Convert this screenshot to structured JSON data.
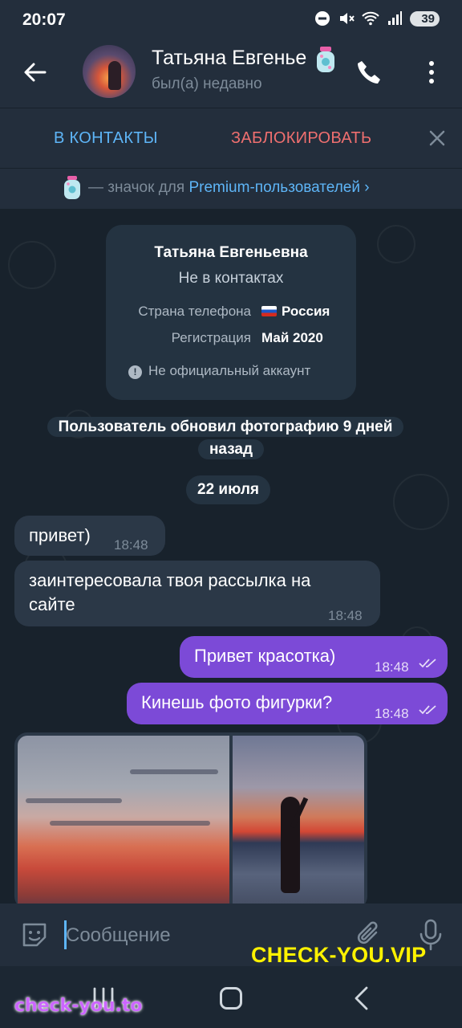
{
  "status_bar": {
    "time": "20:07",
    "battery": "39"
  },
  "header": {
    "title": "Татьяна Евгеньевна",
    "status": "был(а) недавно"
  },
  "actions": {
    "add_contact": "В КОНТАКТЫ",
    "block": "ЗАБЛОКИРОВАТЬ"
  },
  "premium_notice": {
    "text": "— значок для ",
    "link": "Premium-пользователей",
    "chevron": "›"
  },
  "info_card": {
    "name": "Татьяна Евгеньевна",
    "subtitle": "Не в контактах",
    "rows": [
      {
        "key": "Страна телефона",
        "value": "Россия"
      },
      {
        "key": "Регистрация",
        "value": "Май 2020"
      }
    ],
    "warning": "Не официальный аккаунт"
  },
  "service_message": "Пользователь обновил фотографию 9 дней назад",
  "date_separator": "22 июля",
  "messages": [
    {
      "direction": "in",
      "text": "привет)",
      "time": "18:48"
    },
    {
      "direction": "in",
      "text": "заинтересовала твоя рассылка на сайте",
      "time": "18:48"
    },
    {
      "direction": "out",
      "text": "Привет красотка)",
      "time": "18:48",
      "read": true
    },
    {
      "direction": "out",
      "text": "Кинешь фото фигурки?",
      "time": "18:48",
      "read": true
    }
  ],
  "input": {
    "placeholder": "Сообщение"
  },
  "watermarks": {
    "top": "CHECK-YOU.VIP",
    "bottom": "check-you.to"
  },
  "colors": {
    "accent": "#5eb5f7",
    "danger": "#ef6f6f",
    "outgoing": "#7c4ad7",
    "incoming": "#2b3847",
    "background": "#18222c",
    "watermark_yellow": "#fff200"
  }
}
